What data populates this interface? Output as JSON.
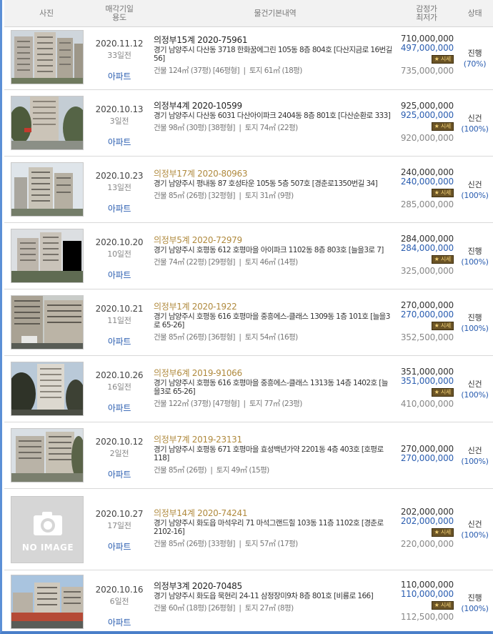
{
  "header": {
    "photo": "사진",
    "date_line1": "매각기일",
    "date_line2": "용도",
    "info": "물건기본내역",
    "price_line1": "감정가",
    "price_line2": "최저가",
    "status": "상태"
  },
  "rows": [
    {
      "date": "2020.11.12",
      "ago": "33일전",
      "usage": "아파트",
      "case": "의정부15계 2020-75961",
      "address": "경기 남양주시 다산동 3718 한화꿈에그린 105동 8층 804호 [다산지금로 16번길 56]",
      "building": "건물 124㎡ (37평) [46평형]",
      "land": "토지 61㎡ (18평)",
      "appraisal": "710,000,000",
      "minimum": "497,000,000",
      "badge": "시세",
      "market": "735,000,000",
      "status": "진행",
      "percent": "(70%)"
    },
    {
      "date": "2020.10.13",
      "ago": "3일전",
      "usage": "아파트",
      "case": "의정부4계 2020-10599",
      "address": "경기 남양주시 다산동 6031 다산아이파크 2404동 8층 801호 [다산순환로 333]",
      "building": "건물 98㎡ (30평) [38평형]",
      "land": "토지 74㎡ (22평)",
      "appraisal": "925,000,000",
      "minimum": "925,000,000",
      "badge": "시세",
      "market": "920,000,000",
      "status": "신건",
      "percent": "(100%)"
    },
    {
      "date": "2020.10.23",
      "ago": "13일전",
      "usage": "아파트",
      "case": "의정부17계 2020-80963",
      "address": "경기 남양주시 평내동 87 호성타운 105동 5층 507호 [경춘로1350번길 34]",
      "building": "건물 85㎡ (26평) [32평형]",
      "land": "토지 31㎡ (9평)",
      "appraisal": "240,000,000",
      "minimum": "240,000,000",
      "badge": "시세",
      "market": "285,000,000",
      "status": "신건",
      "percent": "(100%)"
    },
    {
      "date": "2020.10.20",
      "ago": "10일전",
      "usage": "아파트",
      "case": "의정부5계 2020-72979",
      "address": "경기 남양주시 호평동 612 호평마을 아이파크 1102동 8층 803호 [늘을3로 7]",
      "building": "건물 74㎡ (22평) [29평형]",
      "land": "토지 46㎡ (14평)",
      "appraisal": "284,000,000",
      "minimum": "284,000,000",
      "badge": "시세",
      "market": "325,000,000",
      "status": "진행",
      "percent": "(100%)"
    },
    {
      "date": "2020.10.21",
      "ago": "11일전",
      "usage": "아파트",
      "case": "의정부1계 2020-1922",
      "address": "경기 남양주시 호평동 616 호평마을 중흥에스-클래스 1309동 1층 101호 [늘을3로 65-26]",
      "building": "건물 85㎡ (26평) [36평형]",
      "land": "토지 54㎡ (16평)",
      "appraisal": "270,000,000",
      "minimum": "270,000,000",
      "badge": "시세",
      "market": "352,500,000",
      "status": "진행",
      "percent": "(100%)"
    },
    {
      "date": "2020.10.26",
      "ago": "16일전",
      "usage": "아파트",
      "case": "의정부6계 2019-91066",
      "address": "경기 남양주시 호평동 616 호평마을 중흥에스-클래스 1313동 14층 1402호 [늘을3로 65-26]",
      "building": "건물 122㎡ (37평) [47평형]",
      "land": "토지 77㎡ (23평)",
      "appraisal": "351,000,000",
      "minimum": "351,000,000",
      "badge": "시세",
      "market": "410,000,000",
      "status": "신건",
      "percent": "(100%)"
    },
    {
      "date": "2020.10.12",
      "ago": "2일전",
      "usage": "아파트",
      "case": "의정부7계 2019-23131",
      "address": "경기 남양주시 호평동 671 호평마을 효성백년가약 2201동 4층 403호 [호평로 118]",
      "building": "건물 85㎡ (26평)",
      "land": "토지 49㎡ (15평)",
      "appraisal": "270,000,000",
      "minimum": "270,000,000",
      "badge": "",
      "market": "",
      "status": "신건",
      "percent": "(100%)"
    },
    {
      "date": "2020.10.27",
      "ago": "17일전",
      "usage": "아파트",
      "case": "의정부14계 2020-74241",
      "address": "경기 남양주시 화도읍 마석우리 71 마석그랜드힐 103동 11층 1102호 [경춘로 2102-16]",
      "building": "건물 85㎡ (26평) [33평형]",
      "land": "토지 57㎡ (17평)",
      "appraisal": "202,000,000",
      "minimum": "202,000,000",
      "badge": "시세",
      "market": "220,000,000",
      "status": "신건",
      "percent": "(100%)",
      "no_image": "NO IMAGE"
    },
    {
      "date": "2020.10.16",
      "ago": "6일전",
      "usage": "아파트",
      "case": "의정부3계 2020-70485",
      "address": "경기 남양주시 화도읍 묵현리 24-11 삼정장미9차 8층 801호 [비룡로 166]",
      "building": "건물 60㎡ (18평) [26평형]",
      "land": "토지 27㎡ (8평)",
      "appraisal": "110,000,000",
      "minimum": "110,000,000",
      "badge": "시세",
      "market": "112,500,000",
      "status": "진행",
      "percent": "(100%)"
    }
  ]
}
